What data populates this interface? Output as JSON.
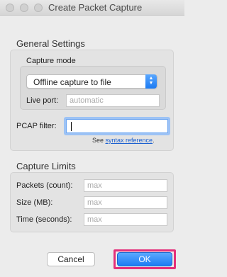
{
  "window": {
    "title": "Create Packet Capture"
  },
  "general": {
    "title": "General Settings",
    "capture_mode": {
      "title": "Capture mode",
      "selected": "Offline capture to file",
      "live_port_label": "Live port:",
      "live_port_placeholder": "automatic"
    },
    "pcap_filter": {
      "label": "PCAP filter:",
      "value": "",
      "hint_prefix": "See ",
      "hint_link": "syntax reference",
      "hint_suffix": "."
    }
  },
  "limits": {
    "title": "Capture Limits",
    "packets_label": "Packets (count):",
    "packets_placeholder": "max",
    "size_label": "Size (MB):",
    "size_placeholder": "max",
    "time_label": "Time (seconds):",
    "time_placeholder": "max"
  },
  "buttons": {
    "cancel": "Cancel",
    "ok": "OK"
  },
  "colors": {
    "accent": "#1c7cf3",
    "highlight": "#e4307a"
  }
}
